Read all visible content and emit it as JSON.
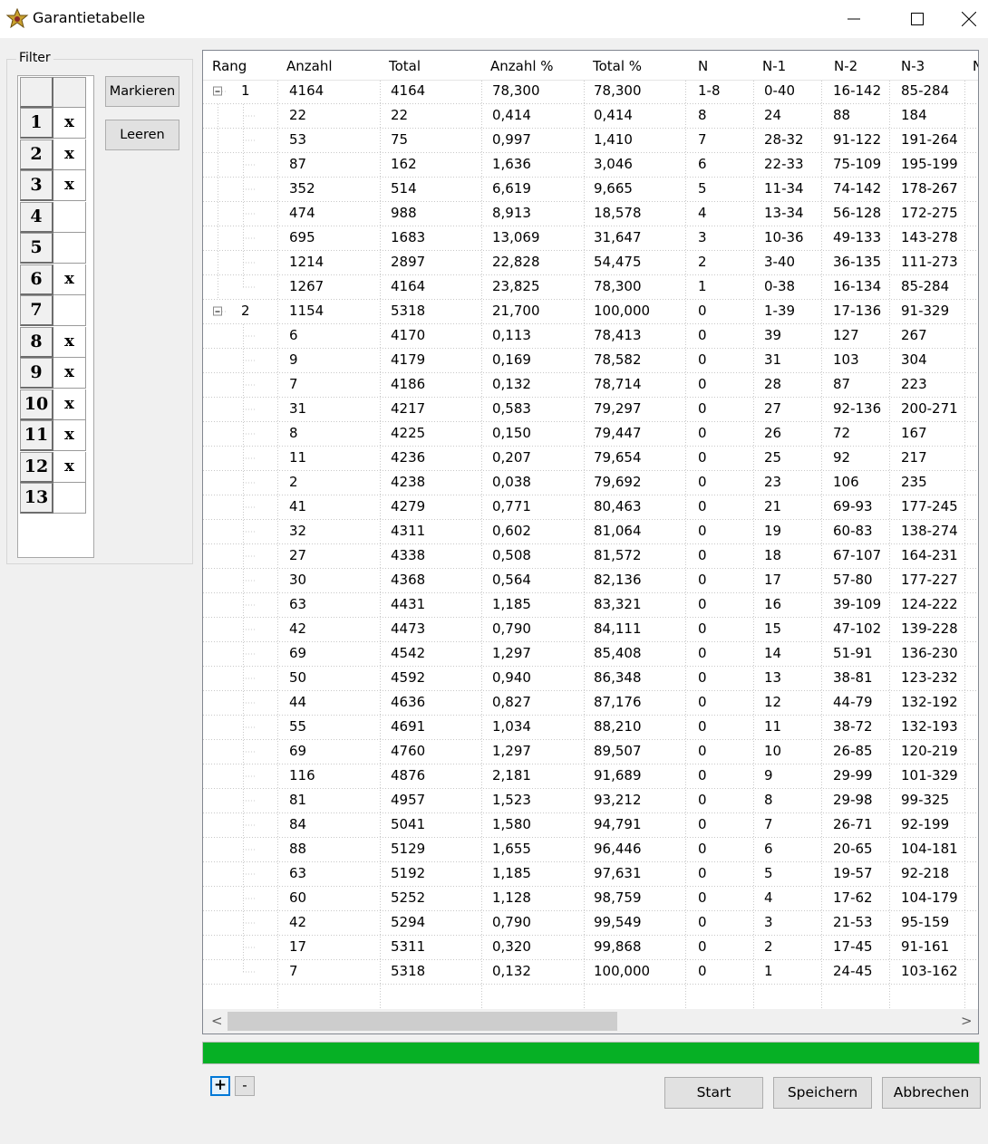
{
  "window": {
    "title": "Garantietabelle",
    "minimize": "—",
    "maximize": "☐",
    "close": "✕"
  },
  "filter": {
    "label": "Filter",
    "rows": [
      {
        "n": "1",
        "x": "x"
      },
      {
        "n": "2",
        "x": "x"
      },
      {
        "n": "3",
        "x": "x"
      },
      {
        "n": "4",
        "x": ""
      },
      {
        "n": "5",
        "x": ""
      },
      {
        "n": "6",
        "x": "x"
      },
      {
        "n": "7",
        "x": ""
      },
      {
        "n": "8",
        "x": "x"
      },
      {
        "n": "9",
        "x": "x"
      },
      {
        "n": "10",
        "x": "x"
      },
      {
        "n": "11",
        "x": "x"
      },
      {
        "n": "12",
        "x": "x"
      },
      {
        "n": "13",
        "x": ""
      }
    ],
    "markieren": "Markieren",
    "leeren": "Leeren"
  },
  "table": {
    "columns": [
      "Rang",
      "Anzahl",
      "Total",
      "Anzahl %",
      "Total %",
      "N",
      "N-1",
      "N-2",
      "N-3",
      "N"
    ],
    "groups": [
      {
        "rang": "1",
        "parent": [
          "4164",
          "4164",
          "78,300",
          "78,300",
          "1-8",
          "0-40",
          "16-142",
          "85-284"
        ],
        "children": [
          [
            "22",
            "22",
            "0,414",
            "0,414",
            "8",
            "24",
            "88",
            "184"
          ],
          [
            "53",
            "75",
            "0,997",
            "1,410",
            "7",
            "28-32",
            "91-122",
            "191-264"
          ],
          [
            "87",
            "162",
            "1,636",
            "3,046",
            "6",
            "22-33",
            "75-109",
            "195-199"
          ],
          [
            "352",
            "514",
            "6,619",
            "9,665",
            "5",
            "11-34",
            "74-142",
            "178-267"
          ],
          [
            "474",
            "988",
            "8,913",
            "18,578",
            "4",
            "13-34",
            "56-128",
            "172-275"
          ],
          [
            "695",
            "1683",
            "13,069",
            "31,647",
            "3",
            "10-36",
            "49-133",
            "143-278"
          ],
          [
            "1214",
            "2897",
            "22,828",
            "54,475",
            "2",
            "3-40",
            "36-135",
            "111-273"
          ],
          [
            "1267",
            "4164",
            "23,825",
            "78,300",
            "1",
            "0-38",
            "16-134",
            "85-284"
          ]
        ]
      },
      {
        "rang": "2",
        "parent": [
          "1154",
          "5318",
          "21,700",
          "100,000",
          "0",
          "1-39",
          "17-136",
          "91-329"
        ],
        "children": [
          [
            "6",
            "4170",
            "0,113",
            "78,413",
            "0",
            "39",
            "127",
            "267"
          ],
          [
            "9",
            "4179",
            "0,169",
            "78,582",
            "0",
            "31",
            "103",
            "304"
          ],
          [
            "7",
            "4186",
            "0,132",
            "78,714",
            "0",
            "28",
            "87",
            "223"
          ],
          [
            "31",
            "4217",
            "0,583",
            "79,297",
            "0",
            "27",
            "92-136",
            "200-271"
          ],
          [
            "8",
            "4225",
            "0,150",
            "79,447",
            "0",
            "26",
            "72",
            "167"
          ],
          [
            "11",
            "4236",
            "0,207",
            "79,654",
            "0",
            "25",
            "92",
            "217"
          ],
          [
            "2",
            "4238",
            "0,038",
            "79,692",
            "0",
            "23",
            "106",
            "235"
          ],
          [
            "41",
            "4279",
            "0,771",
            "80,463",
            "0",
            "21",
            "69-93",
            "177-245"
          ],
          [
            "32",
            "4311",
            "0,602",
            "81,064",
            "0",
            "19",
            "60-83",
            "138-274"
          ],
          [
            "27",
            "4338",
            "0,508",
            "81,572",
            "0",
            "18",
            "67-107",
            "164-231"
          ],
          [
            "30",
            "4368",
            "0,564",
            "82,136",
            "0",
            "17",
            "57-80",
            "177-227"
          ],
          [
            "63",
            "4431",
            "1,185",
            "83,321",
            "0",
            "16",
            "39-109",
            "124-222"
          ],
          [
            "42",
            "4473",
            "0,790",
            "84,111",
            "0",
            "15",
            "47-102",
            "139-228"
          ],
          [
            "69",
            "4542",
            "1,297",
            "85,408",
            "0",
            "14",
            "51-91",
            "136-230"
          ],
          [
            "50",
            "4592",
            "0,940",
            "86,348",
            "0",
            "13",
            "38-81",
            "123-232"
          ],
          [
            "44",
            "4636",
            "0,827",
            "87,176",
            "0",
            "12",
            "44-79",
            "132-192"
          ],
          [
            "55",
            "4691",
            "1,034",
            "88,210",
            "0",
            "11",
            "38-72",
            "132-193"
          ],
          [
            "69",
            "4760",
            "1,297",
            "89,507",
            "0",
            "10",
            "26-85",
            "120-219"
          ],
          [
            "116",
            "4876",
            "2,181",
            "91,689",
            "0",
            "9",
            "29-99",
            "101-329"
          ],
          [
            "81",
            "4957",
            "1,523",
            "93,212",
            "0",
            "8",
            "29-98",
            "99-325"
          ],
          [
            "84",
            "5041",
            "1,580",
            "94,791",
            "0",
            "7",
            "26-71",
            "92-199"
          ],
          [
            "88",
            "5129",
            "1,655",
            "96,446",
            "0",
            "6",
            "20-65",
            "104-181"
          ],
          [
            "63",
            "5192",
            "1,185",
            "97,631",
            "0",
            "5",
            "19-57",
            "92-218"
          ],
          [
            "60",
            "5252",
            "1,128",
            "98,759",
            "0",
            "4",
            "17-62",
            "104-179"
          ],
          [
            "42",
            "5294",
            "0,790",
            "99,549",
            "0",
            "3",
            "21-53",
            "95-159"
          ],
          [
            "17",
            "5311",
            "0,320",
            "99,868",
            "0",
            "2",
            "17-45",
            "91-161"
          ],
          [
            "7",
            "5318",
            "0,132",
            "100,000",
            "0",
            "1",
            "24-45",
            "103-162"
          ]
        ]
      }
    ],
    "scroll_left": "<",
    "scroll_right": ">"
  },
  "progress": {
    "value_percent": 100,
    "color": "#06b025"
  },
  "buttons": {
    "plus": "+",
    "minus": "-",
    "start": "Start",
    "speichern": "Speichern",
    "abbrechen": "Abbrechen"
  }
}
